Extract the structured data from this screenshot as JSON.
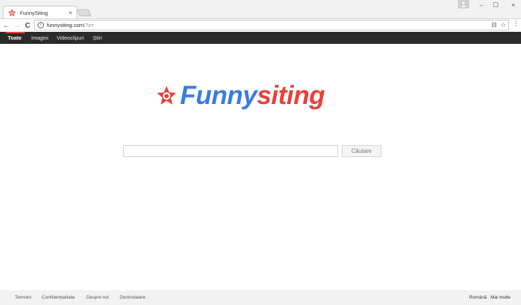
{
  "browser": {
    "tab_title": "FunnySiting",
    "tab_close": "×",
    "url_main": "funnysiting.com",
    "url_rest": "/?z=",
    "window_controls": {
      "minimize": "–",
      "maximize": "☐",
      "close": "×"
    },
    "nav": {
      "back": "←",
      "forward": "→",
      "reload": "C"
    },
    "menu": "⋮",
    "omnibox_icons": {
      "translate": "⊟",
      "bookmark": "☆"
    },
    "site_info_icon": "i"
  },
  "sitenav": {
    "items": [
      {
        "label": "Toate",
        "active": true
      },
      {
        "label": "Imagini",
        "active": false
      },
      {
        "label": "Videoclipuri",
        "active": false
      },
      {
        "label": "Știri",
        "active": false
      }
    ]
  },
  "logo": {
    "part1": "Funny",
    "part2": "siting",
    "colors": {
      "blue": "#3b7de0",
      "red": "#e8413c"
    }
  },
  "search": {
    "value": "",
    "button_label": "Căutare"
  },
  "footer": {
    "left_links": [
      "Termeni",
      "Confidențialitate",
      "Despre noi",
      "Dezinstalare"
    ],
    "language": "Română",
    "more": "Mai multe"
  }
}
